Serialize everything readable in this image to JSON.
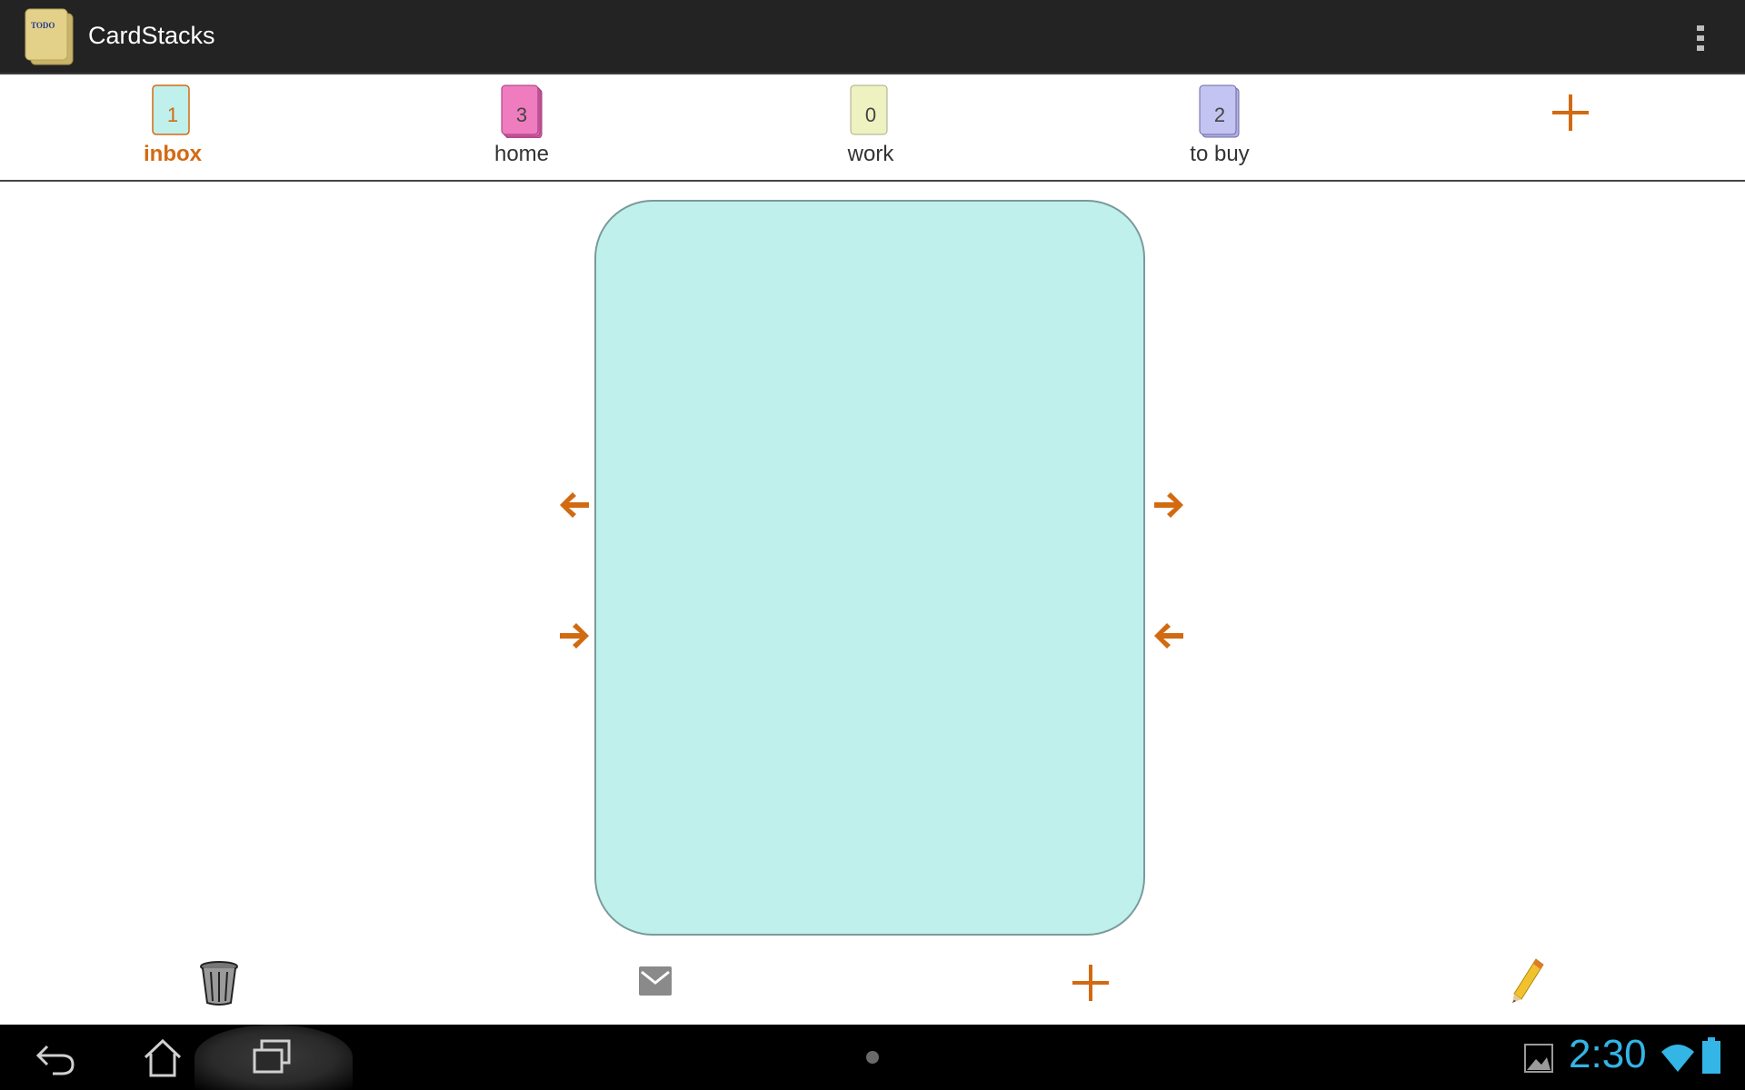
{
  "app": {
    "title": "CardStacks",
    "icon": "todo-cards-icon",
    "icon_text": "TODO"
  },
  "stacks": [
    {
      "label": "inbox",
      "count": "1",
      "color": "#bff0ec",
      "active": true
    },
    {
      "label": "home",
      "count": "3",
      "color": "#f07cc0",
      "active": false
    },
    {
      "label": "work",
      "count": "0",
      "color": "#eef2c0",
      "active": false
    },
    {
      "label": "to buy",
      "count": "2",
      "color": "#c4c4f2",
      "active": false
    }
  ],
  "colors": {
    "accent": "#d26a12",
    "card": "#bff0ec",
    "action_bar": "#232323",
    "clock": "#33b5e5"
  },
  "toolbar": {
    "icons": [
      "trash-icon",
      "email-icon",
      "add-card-icon",
      "edit-pencil-icon"
    ]
  },
  "status": {
    "time": "2:30"
  }
}
